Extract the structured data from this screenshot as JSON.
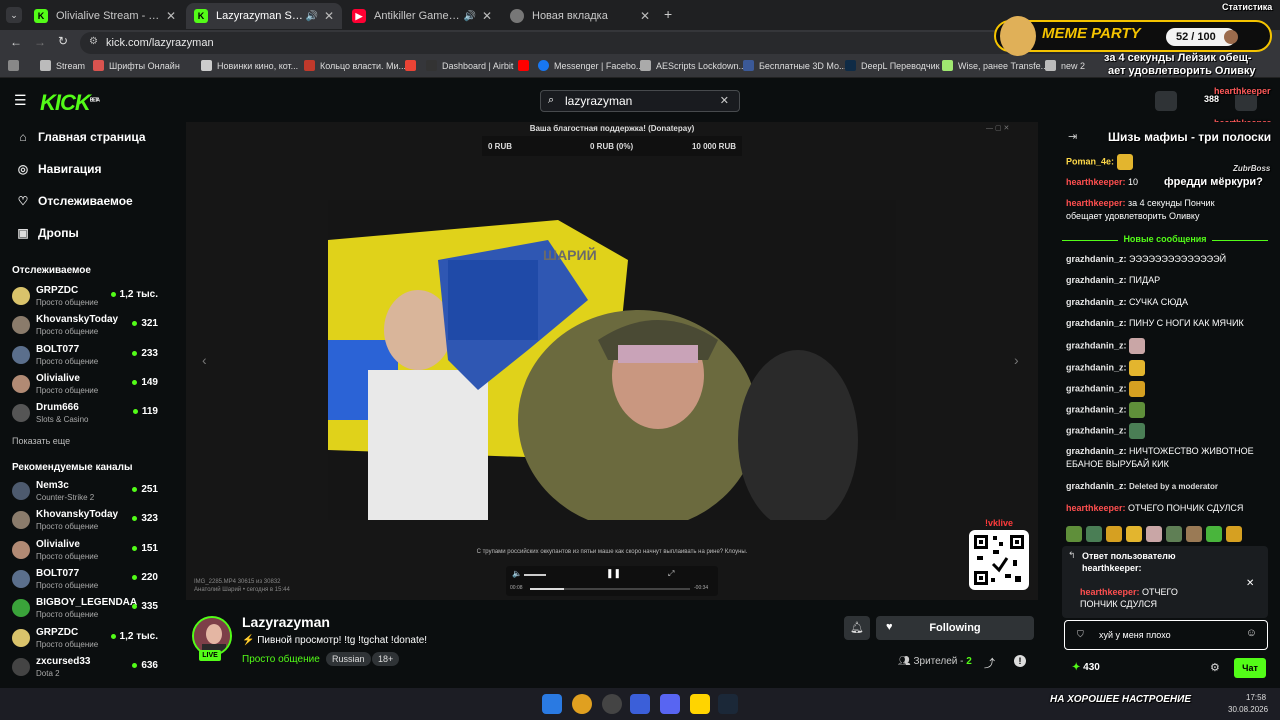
{
  "browser": {
    "tabs": [
      {
        "label": "Olivialive Stream - Watch Live o",
        "favicon": "kick-icon",
        "color": "#53fc18"
      },
      {
        "label": "Lazyrazyman Stream - Watch",
        "favicon": "kick-icon",
        "color": "#53fc18"
      },
      {
        "label": "Antikiller Game Soundtrack",
        "favicon": "youtube-icon",
        "color": "#ff0033"
      },
      {
        "label": "Новая вкладка",
        "favicon": "chrome-icon",
        "color": "#888"
      }
    ],
    "url": "kick.com/lazyrazyman",
    "bookmarks": [
      "Stream",
      "Шрифты Онлайн",
      "Новинки кино, кот...",
      "Кольцо власти. Ми...",
      "Dashboard | Airbit",
      "Messenger | Facebo...",
      "AEScripts Lockdown...",
      "Бесплатные 3D Мо...",
      "DeepL Переводчик",
      "Wise, ранее Transfe...",
      "new 2"
    ]
  },
  "overlay": {
    "meme_party": "MEME PARTY",
    "counter": "52 / 100",
    "stats_label": "Статистика",
    "tts_lines": [
      "за 4 секунды Лейзик обещ-",
      "ает удовлетворить Оливку"
    ],
    "viewer_count": "388",
    "quiz": "Шизь мафиы - три полоски",
    "quiz_author": "ZubrBoss",
    "quiz_answer": "фредди мёркури?",
    "donor": "hearthkeeper"
  },
  "kick": {
    "logo": "KICK",
    "logo_sup": "BETA",
    "search": "lazyrazyman"
  },
  "sidebar": {
    "nav": [
      {
        "label": "Главная страница",
        "icon": "home-icon"
      },
      {
        "label": "Навигация",
        "icon": "compass-icon"
      },
      {
        "label": "Отслеживаемое",
        "icon": "heart-icon"
      },
      {
        "label": "Дропы",
        "icon": "gift-icon"
      }
    ],
    "followed_header": "Отслеживаемое",
    "followed": [
      {
        "name": "GRPZDC",
        "category": "Просто общение",
        "viewers": "1,2 тыс.",
        "color": "#d9c36b"
      },
      {
        "name": "KhovanskyToday",
        "category": "Просто общение",
        "viewers": "321",
        "color": "#8a7b6b"
      },
      {
        "name": "BOLT077",
        "category": "Просто общение",
        "viewers": "233",
        "color": "#5b6f8c"
      },
      {
        "name": "Olivialive",
        "category": "Просто общение",
        "viewers": "149",
        "color": "#b18a74"
      },
      {
        "name": "Drum666",
        "category": "Slots & Casino",
        "viewers": "119",
        "color": "#555"
      }
    ],
    "show_more": "Показать еще",
    "recommended_header": "Рекомендуемые каналы",
    "recommended": [
      {
        "name": "Nem3c",
        "category": "Counter-Strike 2",
        "viewers": "251",
        "color": "#4d5a6e"
      },
      {
        "name": "KhovanskyToday",
        "category": "Просто общение",
        "viewers": "323",
        "color": "#8a7b6b"
      },
      {
        "name": "Olivialive",
        "category": "Просто общение",
        "viewers": "151",
        "color": "#b18a74"
      },
      {
        "name": "BOLT077",
        "category": "Просто общение",
        "viewers": "220",
        "color": "#5b6f8c"
      },
      {
        "name": "BIGBOY_LEGENDAA",
        "category": "Просто общение",
        "viewers": "335",
        "color": "#3aa33a"
      },
      {
        "name": "GRPZDC",
        "category": "Просто общение",
        "viewers": "1,2 тыс.",
        "color": "#d9c36b"
      },
      {
        "name": "zxcursed33",
        "category": "Dota 2",
        "viewers": "636",
        "color": "#444"
      }
    ]
  },
  "player": {
    "donate_title": "Ваша благостная поддержка! (Donatepay)",
    "donate_values": [
      "0 RUB",
      "0 RUB (0%)",
      "10 000 RUB"
    ],
    "subtitle": "С трупами российских оккупантов из пятьи маше как скоро начнут выплаивать на рине? Клоуны.",
    "video_tag": "ШАРИЙ",
    "file_info": [
      "IMG_2285.MP4 30615 из 30832",
      "Анатолий Шарий • сегодня в 15:44"
    ],
    "time_start": "00:08",
    "time_end": "-00:34",
    "qr_label": "!vklive"
  },
  "stream": {
    "name": "Lazyrazyman",
    "title": "Пивной просмотр! !tg !tgchat !donate!",
    "category": "Просто общение",
    "tags": [
      "Russian",
      "18+"
    ],
    "live": "LIVE",
    "follow_label": "Following",
    "viewers_label": "Зрителей -",
    "viewers": "2"
  },
  "chat": {
    "top": [
      {
        "user": "Poman_4e",
        "text": "",
        "emote": true,
        "ucolor": "y"
      },
      {
        "user": "hearthkeeper",
        "text": "10",
        "ucolor": "r"
      },
      {
        "user": "hearthkeeper",
        "text": "за 4 секунды Пончик обещает удовлетворить Оливку",
        "ucolor": "r"
      }
    ],
    "new_messages": "Новые сообщения",
    "messages": [
      {
        "user": "grazhdanin_z",
        "text": "ЭЭЭЭЭЭЭЭЭЭЭЭЭЭЙ",
        "ucolor": "g"
      },
      {
        "user": "grazhdanin_z",
        "text": "ПИДАР",
        "ucolor": "g"
      },
      {
        "user": "grazhdanin_z",
        "text": "СУЧКА СЮДА",
        "ucolor": "g"
      },
      {
        "user": "grazhdanin_z",
        "text": "ПИНУ С НОГИ КАК МЯЧИК",
        "ucolor": "g"
      },
      {
        "user": "grazhdanin_z",
        "text": "",
        "emote": "#c9a6a6",
        "ucolor": "g"
      },
      {
        "user": "grazhdanin_z",
        "text": "",
        "emote": "#e3b52e",
        "ucolor": "g"
      },
      {
        "user": "grazhdanin_z",
        "text": "",
        "emote": "#d6a021",
        "ucolor": "g"
      },
      {
        "user": "grazhdanin_z",
        "text": "",
        "emote": "#5f8f3a",
        "ucolor": "g"
      },
      {
        "user": "grazhdanin_z",
        "text": "",
        "emote": "#4a7e55",
        "ucolor": "g"
      },
      {
        "user": "grazhdanin_z",
        "text": "НИЧТОЖЕСТВО ЖИВОТНОЕ ЕБАНОЕ ВЫРУБАЙ КИК",
        "ucolor": "g"
      },
      {
        "user": "grazhdanin_z",
        "text": "Deleted by a moderator",
        "ucolor": "g",
        "deleted": true
      },
      {
        "user": "hearthkeeper",
        "text": "ОТЧЕГО ПОНЧИК СДУЛСЯ",
        "ucolor": "r"
      }
    ],
    "reply_header": "Ответ пользователю hearthkeeper:",
    "reply_user": "hearthkeeper",
    "reply_text": "ОТЧЕГО ПОНЧИК СДУЛСЯ",
    "input_value": "хуй у меня плохо",
    "points": "430",
    "send_label": "Чат"
  },
  "taskbar": {
    "ticker": "НА ХОРОШЕЕ НАСТРОЕНИЕ",
    "time": "17:58",
    "date": "30.08.2026"
  },
  "colors": {
    "accent": "#53fc18",
    "background": "#0b0e0f",
    "panel": "#2f3336"
  }
}
